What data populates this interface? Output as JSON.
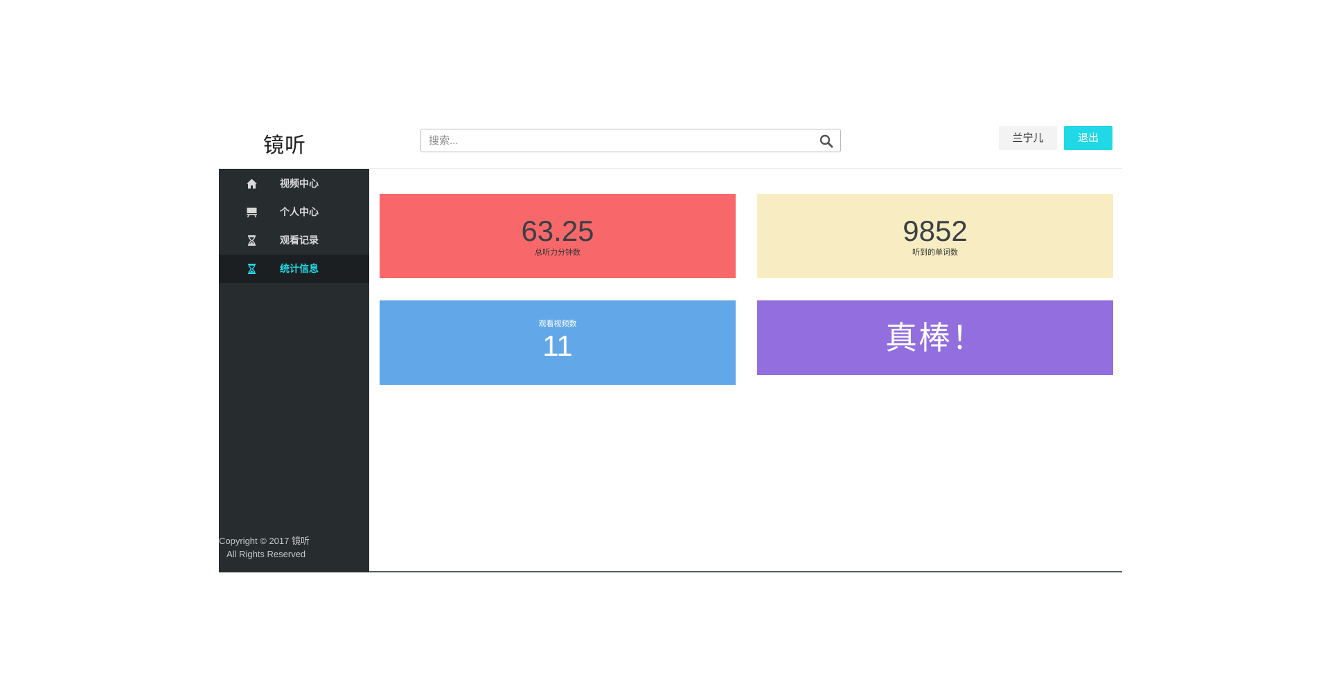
{
  "app": {
    "logo_text": "镜听"
  },
  "header": {
    "search": {
      "placeholder": "搜索...",
      "value": ""
    },
    "user_label": "兰宁儿",
    "logout_label": "退出"
  },
  "sidebar": {
    "items": [
      {
        "label": "视频中心",
        "icon": "home-icon",
        "active": false
      },
      {
        "label": "个人中心",
        "icon": "presentation-icon",
        "active": false
      },
      {
        "label": "观看记录",
        "icon": "hourglass-icon",
        "active": false
      },
      {
        "label": "统计信息",
        "icon": "hourglass-icon",
        "active": true
      }
    ],
    "copyright_line1": "Copyright © 2017 镜听",
    "copyright_line2": "All Rights Reserved"
  },
  "stats": {
    "minutes": {
      "value": "63.25",
      "label": "总听力分钟数"
    },
    "words": {
      "value": "9852",
      "label": "听到的单词数"
    },
    "videos": {
      "value": "11",
      "label": "观看视频数"
    },
    "praise": "真棒！"
  },
  "colors": {
    "accent": "#21d8e6",
    "sidebar_bg": "#272c2f",
    "card_red": "#f8686a",
    "card_yellow": "#f8edc2",
    "card_blue": "#62a8e9",
    "card_purple": "#936ede"
  }
}
